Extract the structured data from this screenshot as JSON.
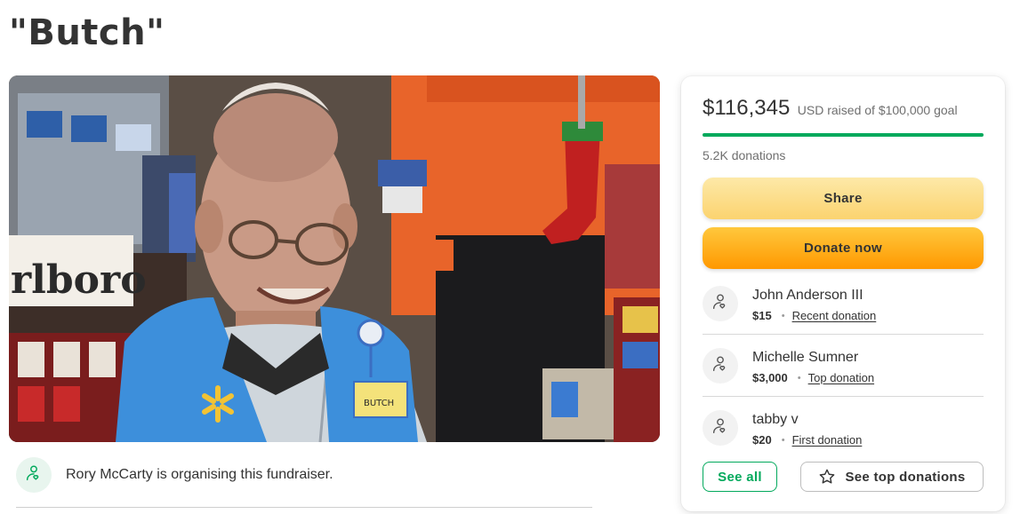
{
  "page": {
    "title": "\"Butch\""
  },
  "organizer": {
    "text": "Rory McCarty is organising this fundraiser."
  },
  "stats": {
    "raised_amount": "$116,345",
    "raised_suffix": "USD raised of $100,000 goal",
    "progress_fraction": 1.0,
    "donation_count": "5.2K donations"
  },
  "buttons": {
    "share": "Share",
    "donate": "Donate now",
    "see_all": "See all",
    "see_top": "See top donations"
  },
  "donations": [
    {
      "name": "John Anderson III",
      "amount": "$15",
      "tag": "Recent donation"
    },
    {
      "name": "Michelle Sumner",
      "amount": "$3,000",
      "tag": "Top donation"
    },
    {
      "name": "tabby v",
      "amount": "$20",
      "tag": "First donation"
    }
  ],
  "hero_image": {
    "label_text": "rlboro",
    "badge_text": "BUTCH"
  },
  "colors": {
    "accent_green": "#02a95c",
    "donate_orange": "#ff9800",
    "share_yellow": "#fbd36f"
  },
  "icons": {
    "organizer": "heart-hand-icon",
    "donor": "heart-hand-icon",
    "star": "star-icon"
  }
}
